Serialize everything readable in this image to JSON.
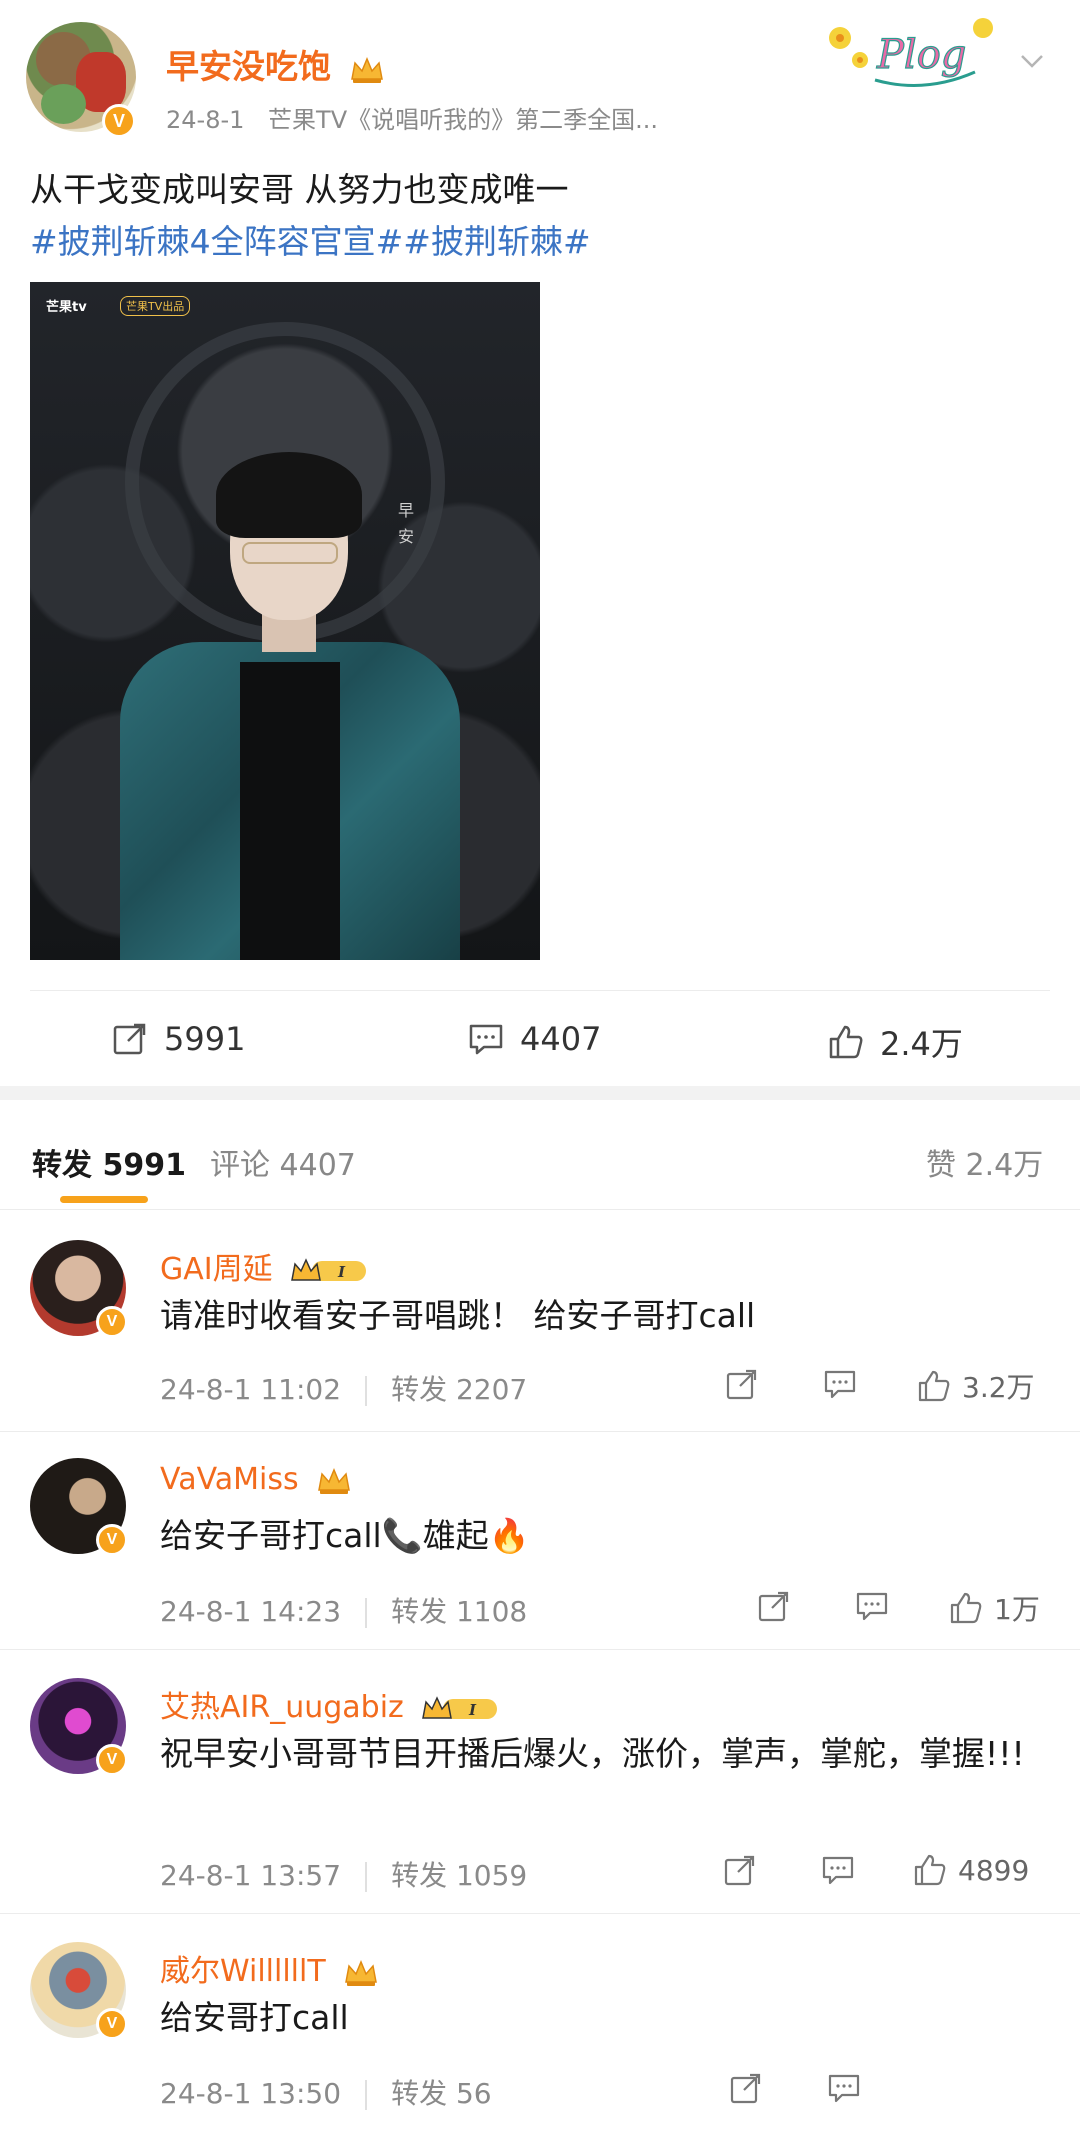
{
  "post": {
    "author": "早安没吃饱",
    "verified_badge": "V",
    "date": "24-8-1",
    "source": "芒果TV《说唱听我的》第二季全国...",
    "text_line1": "从干戈变成叫安哥 从努力也变成唯一",
    "hashtag1": "#披荆斩棘4全阵容官宣#",
    "hashtag2": "#披荆斩棘#",
    "image": {
      "logo_tv": "芒果tv",
      "logo_show": "芒果TV出品",
      "name_text": "早安"
    },
    "plog_label": "Plog",
    "actions": {
      "repost_count": "5991",
      "comment_count": "4407",
      "like_count": "2.4万"
    }
  },
  "tabs": {
    "repost": "转发 5991",
    "comment": "评论 4407",
    "likes": "赞 2.4万"
  },
  "reposts": [
    {
      "name": "GAI周延",
      "vip_level": "I",
      "text": "请准时收看安子哥唱跳！ 给安子哥打call",
      "time": "24-8-1 11:02",
      "repost_label": "转发 2207",
      "like_count": "3.2万"
    },
    {
      "name": "VaVaMiss",
      "text": "给安子哥打call📞雄起🔥",
      "time": "24-8-1 14:23",
      "repost_label": "转发 1108",
      "like_count": "1万"
    },
    {
      "name": "艾热AIR_uugabiz",
      "vip_level": "I",
      "text": "祝早安小哥哥节目开播后爆火，涨价，掌声，掌舵，掌握!!!",
      "time": "24-8-1 13:57",
      "repost_label": "转发 1059",
      "like_count": "4899"
    },
    {
      "name": "威尔WillllllT",
      "text": "给安哥打call",
      "time": "24-8-1 13:50",
      "repost_label": "转发 56",
      "like_count": ""
    }
  ],
  "colors": {
    "accent_orange": "#f26b1d",
    "hashtag_blue": "#3b74c4",
    "badge_orange": "#f7a21b"
  }
}
